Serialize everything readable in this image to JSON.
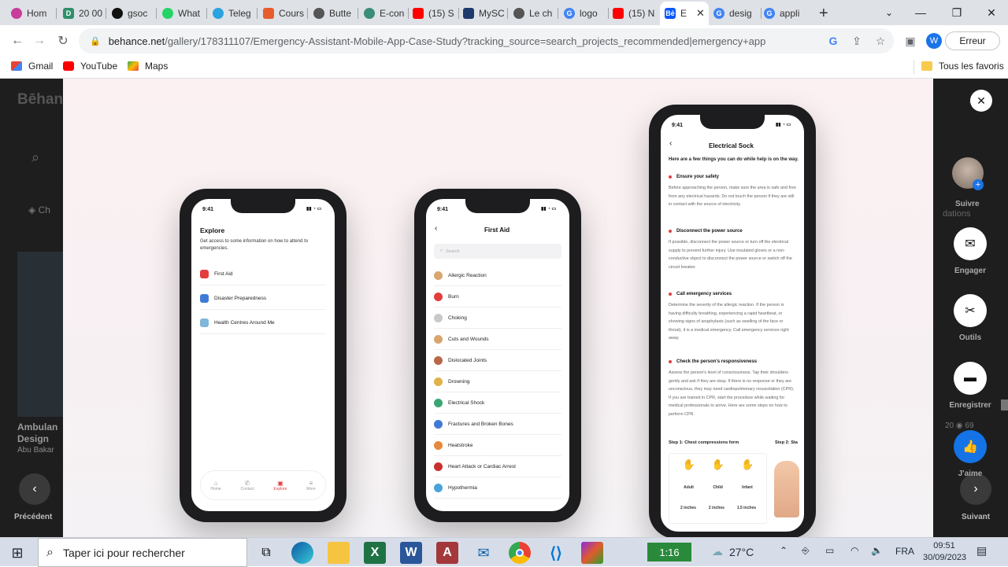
{
  "browser": {
    "tabs": [
      {
        "label": "Hom",
        "color": "#c83d9b"
      },
      {
        "label": "20 00",
        "color": "#2f8f6b"
      },
      {
        "label": "gsoc",
        "color": "#111111"
      },
      {
        "label": "What",
        "color": "#25d366"
      },
      {
        "label": "Teleg",
        "color": "#2aa3df"
      },
      {
        "label": "Cours",
        "color": "#e85c2c"
      },
      {
        "label": "Butte",
        "color": "#555555"
      },
      {
        "label": "E-con",
        "color": "#3a8d7a"
      },
      {
        "label": "(15) S",
        "color": "#ff0000"
      },
      {
        "label": "MySC",
        "color": "#1e3a6d"
      },
      {
        "label": "Le ch",
        "color": "#555555"
      },
      {
        "label": "logo",
        "color": "#4285f4"
      },
      {
        "label": "(15) N",
        "color": "#ff0000"
      },
      {
        "label": "E",
        "color": "#0057ff",
        "active": true
      },
      {
        "label": "desig",
        "color": "#4285f4"
      },
      {
        "label": "appli",
        "color": "#4285f4"
      }
    ],
    "url_main": "behance.net",
    "url_rest": "/gallery/178311107/Emergency-Assistant-Mobile-App-Case-Study?tracking_source=search_projects_recommended|emergency+app",
    "profile_letter": "W",
    "error_label": "Erreur",
    "bookmarks": [
      "Gmail",
      "YouTube",
      "Maps"
    ],
    "all_bookmarks": "Tous les favoris"
  },
  "background_page": {
    "logo": "Bēhance",
    "chip": "Ch",
    "card_title_1": "Ambulan",
    "card_title_2": "Design",
    "card_author": "Abu Bakar",
    "right_label": "Suivre",
    "right_stats_1": "20",
    "right_stats_2": "69",
    "recos": "dations",
    "prev_label": "Précédent",
    "next_label": "Suivant",
    "adobe": "Adobe"
  },
  "side_actions": [
    {
      "label": "Engager",
      "icon": "mail-icon"
    },
    {
      "label": "Outils",
      "icon": "tools-icon"
    },
    {
      "label": "Enregistrer",
      "icon": "folder-icon"
    },
    {
      "label": "J'aime",
      "icon": "thumbs-up-icon"
    }
  ],
  "phone1": {
    "time": "9:41",
    "title": "Explore",
    "subtitle": "Get access to some information on how to attend to emergencies.",
    "items": [
      "First Aid",
      "Disaster Preparedness",
      "Health Centres Around Me"
    ],
    "nav": [
      "Home",
      "Contact",
      "Explore",
      "More"
    ]
  },
  "phone2": {
    "time": "9:41",
    "title": "First Aid",
    "search_placeholder": "Search",
    "items": [
      "Allergic Reaction",
      "Burn",
      "Choking",
      "Cuts and Wounds",
      "Dislocated Joints",
      "Drowning",
      "Electrical Shock",
      "Fractures and Broken Bones",
      "Heatstroke",
      "Heart Attack or Cardiac Arrest",
      "Hypothermia"
    ]
  },
  "phone3": {
    "time": "9:41",
    "title": "Electrical Sock",
    "intro": "Here are a few things you can do while help is on the way.",
    "sections": [
      {
        "head": "Ensure your safety",
        "body": "Before approaching the person, make sure the area is safe and free from any electrical hazards. Do not touch the person if they are still in contact with the source of electricity."
      },
      {
        "head": "Disconnect the power source",
        "body": "If possible, disconnect the power source or turn off the electrical supply to prevent further injury. Use insulated gloves or a non-conductive object to disconnect the power source or switch off the circuit breaker."
      },
      {
        "head": "Call emergency services",
        "body": "Determine the severity of the allergic reaction. If the person is having difficulty breathing, experiencing a rapid heartbeat, or showing signs of anaphylaxis (such as swelling of the face or throat), it is a medical emergency. Call emergency services right away."
      },
      {
        "head": "Check the person's responsiveness",
        "body": "Assess the person's level of consciousness. Tap their shoulders gently and ask if they are okay. If there is no response or they are unconscious, they may need cardiopulmonary resuscitation (CPR). If you are trained in CPR, start the procedure while waiting for medical professionals to arrive. Here are some steps on how to perform CPR."
      }
    ],
    "step1": "Step 1: Chest compressions form",
    "step2": "Step 2: Sta",
    "figures": [
      "Adult",
      "Child",
      "Infant"
    ],
    "depths": [
      "2 inches",
      "2 inches",
      "1.5 inches"
    ]
  },
  "taskbar": {
    "search_placeholder": "Taper ici pour rechercher",
    "media_time": "1:16",
    "weather": "27°C",
    "lang": "FRA",
    "time": "09:51",
    "date": "30/09/2023"
  }
}
